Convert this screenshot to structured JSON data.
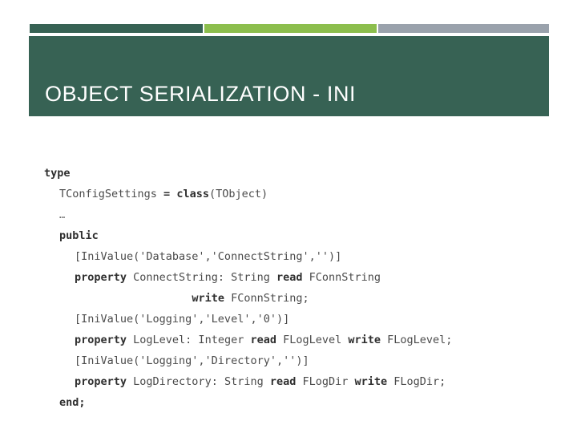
{
  "slide": {
    "title": "OBJECT SERIALIZATION - INI",
    "background_color": "#ffffff"
  },
  "accent_rule": {
    "segments": [
      {
        "name": "dark-green-segment",
        "color": "#376254"
      },
      {
        "name": "lime-green-segment",
        "color": "#8CBE4D"
      },
      {
        "name": "gray-segment",
        "color": "#9AA2AC"
      }
    ]
  },
  "title_banner": {
    "fill_color": "#376254",
    "text_color": "#ffffff"
  },
  "code": {
    "language": "Delphi / Object Pascal",
    "lines": [
      {
        "indent": 0,
        "tokens": [
          {
            "t": "type",
            "kw": true
          }
        ]
      },
      {
        "indent": 1,
        "tokens": [
          {
            "t": "TConfigSettings ",
            "kw": false
          },
          {
            "t": "= ",
            "kw": true
          },
          {
            "t": "class",
            "kw": true
          },
          {
            "t": "(TObject)",
            "kw": false
          }
        ]
      },
      {
        "indent": 1,
        "tokens": [
          {
            "t": "…",
            "kw": false,
            "ell": true
          }
        ]
      },
      {
        "indent": 1,
        "tokens": [
          {
            "t": "public",
            "kw": true
          }
        ]
      },
      {
        "indent": 2,
        "tokens": [
          {
            "t": "[IniValue('Database','ConnectString','')]",
            "kw": false
          }
        ]
      },
      {
        "indent": 2,
        "tokens": [
          {
            "t": "property",
            "kw": true
          },
          {
            "t": " ConnectString: String ",
            "kw": false
          },
          {
            "t": "read",
            "kw": true
          },
          {
            "t": " FConnString",
            "kw": false
          }
        ]
      },
      {
        "indent": 2,
        "tokens": [
          {
            "t": "                  ",
            "kw": false
          },
          {
            "t": "write",
            "kw": true
          },
          {
            "t": " FConnString;",
            "kw": false
          }
        ]
      },
      {
        "indent": 2,
        "tokens": [
          {
            "t": "[IniValue('Logging','Level','0')]",
            "kw": false
          }
        ]
      },
      {
        "indent": 2,
        "tokens": [
          {
            "t": "property",
            "kw": true
          },
          {
            "t": " LogLevel: Integer ",
            "kw": false
          },
          {
            "t": "read",
            "kw": true
          },
          {
            "t": " FLogLevel ",
            "kw": false
          },
          {
            "t": "write",
            "kw": true
          },
          {
            "t": " FLogLevel;",
            "kw": false
          }
        ]
      },
      {
        "indent": 2,
        "tokens": [
          {
            "t": "[IniValue('Logging','Directory','')]",
            "kw": false
          }
        ]
      },
      {
        "indent": 2,
        "tokens": [
          {
            "t": "property",
            "kw": true
          },
          {
            "t": " LogDirectory: String ",
            "kw": false
          },
          {
            "t": "read",
            "kw": true
          },
          {
            "t": " FLogDir ",
            "kw": false
          },
          {
            "t": "write",
            "kw": true
          },
          {
            "t": " FLogDir;",
            "kw": false
          }
        ]
      },
      {
        "indent": 1,
        "tokens": [
          {
            "t": "end;",
            "kw": true
          }
        ]
      }
    ]
  }
}
